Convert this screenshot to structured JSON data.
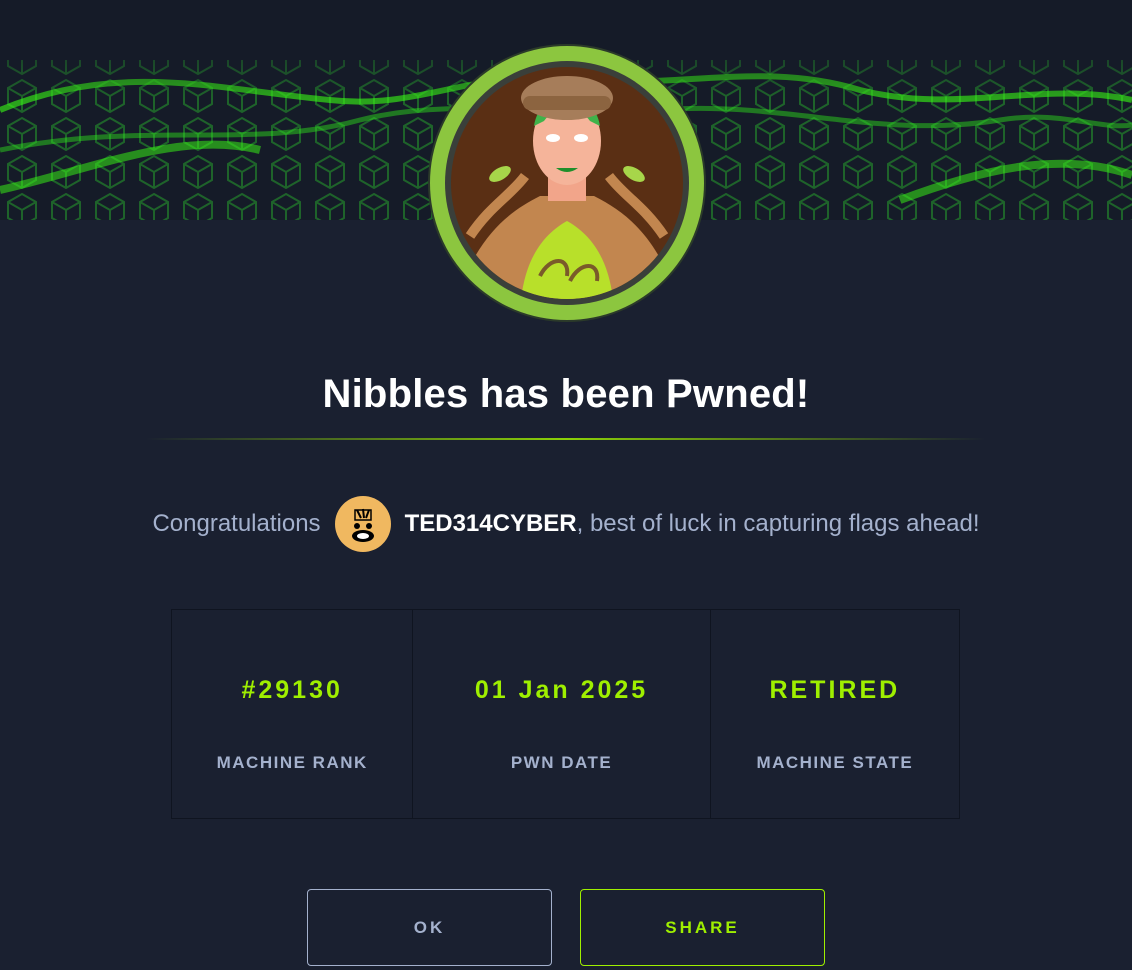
{
  "colors": {
    "background": "#1a2030",
    "accent": "#9fef00",
    "muted_text": "#a4b1cd",
    "avatar_ring": "#8cc63f"
  },
  "banner": {
    "icon": "green-cube-wave-banner"
  },
  "machine": {
    "avatar_icon": "nibbles-machine-avatar"
  },
  "title": "Nibbles has been Pwned!",
  "congrats": {
    "prefix": "Congratulations",
    "user_avatar_icon": "user-avatar-icon",
    "username": "TED314CYBER",
    "suffix": ", best of luck in capturing flags ahead!"
  },
  "stats": [
    {
      "value": "#29130",
      "label": "MACHINE RANK"
    },
    {
      "value": "01 Jan 2025",
      "label": "PWN DATE"
    },
    {
      "value": "RETIRED",
      "label": "MACHINE STATE"
    }
  ],
  "buttons": {
    "ok_label": "OK",
    "share_label": "SHARE"
  }
}
